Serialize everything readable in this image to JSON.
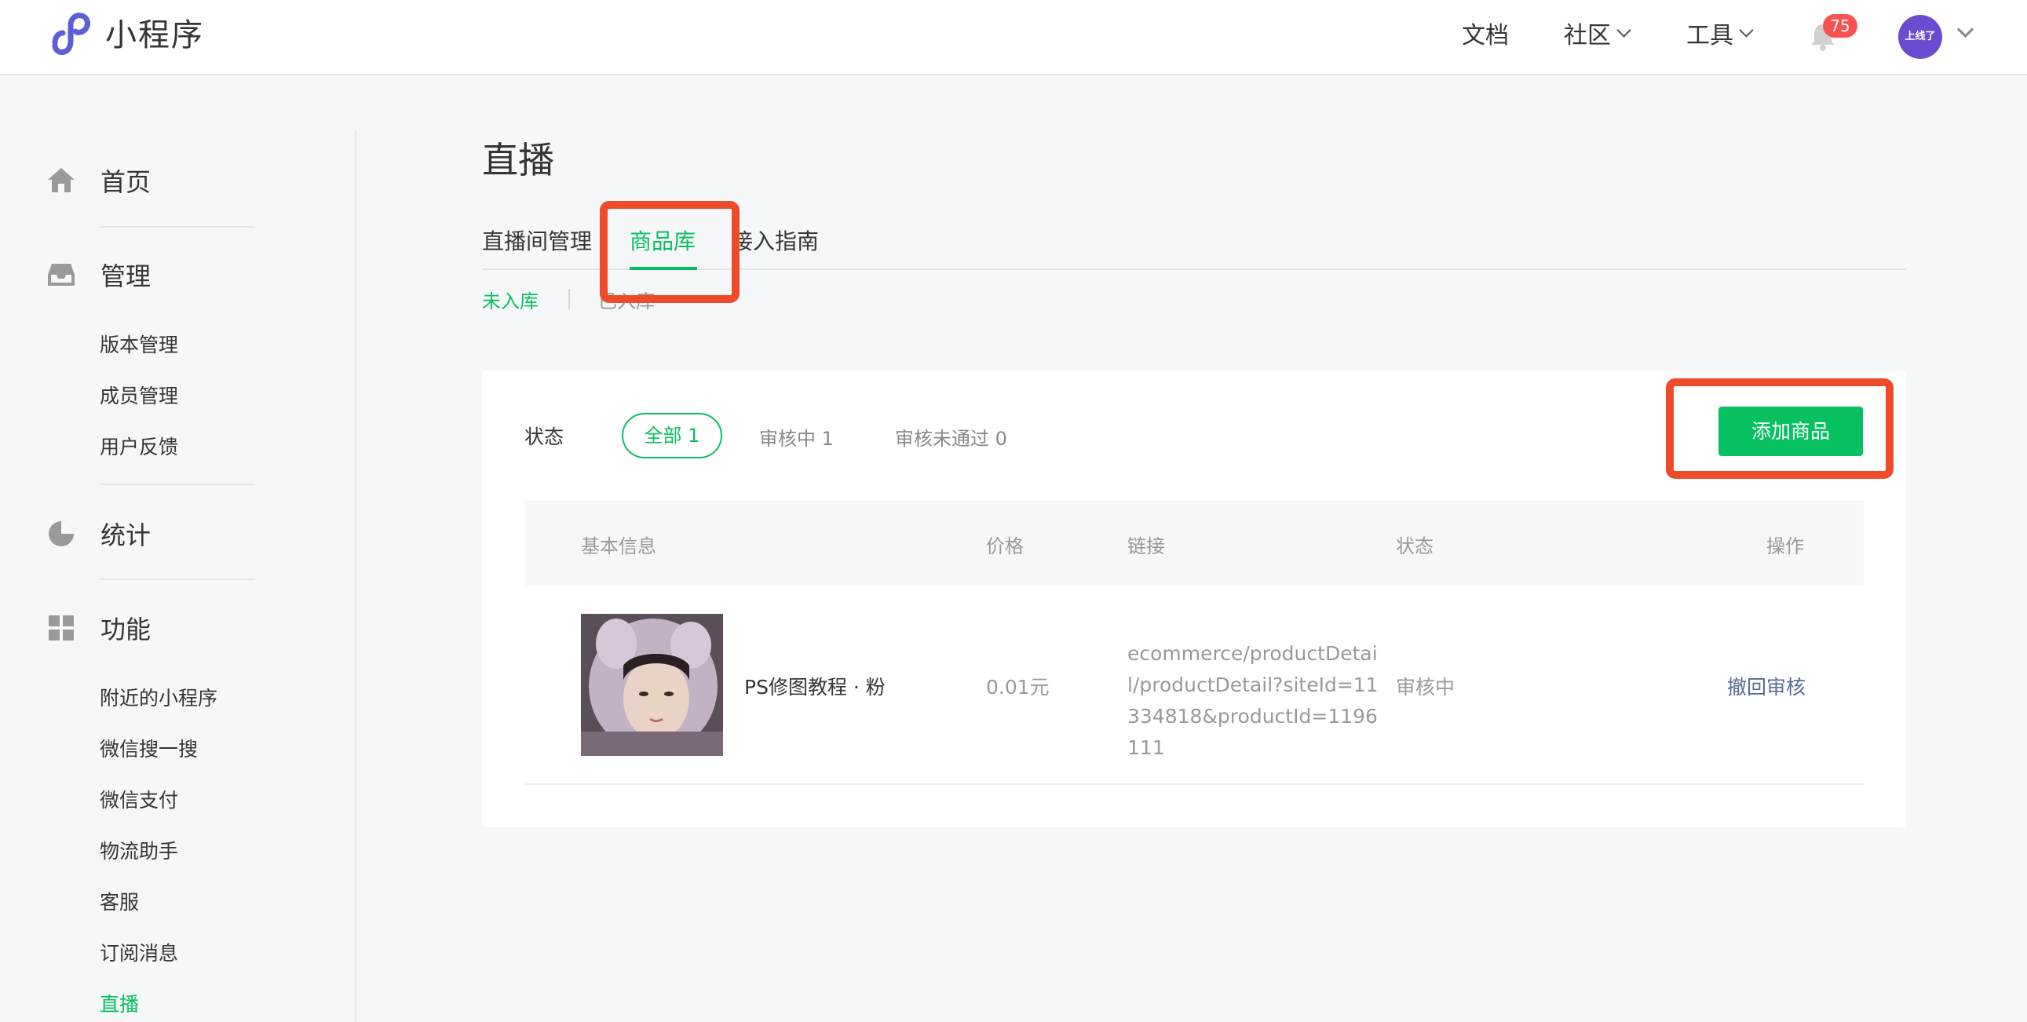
{
  "header": {
    "app_name": "小程序",
    "nav": [
      "文档",
      "社区",
      "工具"
    ],
    "notification_count": "75",
    "avatar_text": "上线了",
    "colors": {
      "brand": "#07c160",
      "logo": "#5b5fd8"
    }
  },
  "sidebar": {
    "groups": [
      {
        "label": "首页",
        "icon": "home-icon"
      },
      {
        "label": "管理",
        "icon": "inbox-icon"
      },
      {
        "label": "统计",
        "icon": "pie-chart-icon"
      },
      {
        "label": "功能",
        "icon": "grid-icon"
      }
    ],
    "manage_items": [
      "版本管理",
      "成员管理",
      "用户反馈"
    ],
    "feature_items": [
      "附近的小程序",
      "微信搜一搜",
      "微信支付",
      "物流助手",
      "客服",
      "订阅消息",
      "直播"
    ],
    "active_item": "直播"
  },
  "main": {
    "title": "直播",
    "tabs": [
      "直播间管理",
      "商品库",
      "接入指南"
    ],
    "active_tab": "商品库",
    "subtabs": [
      "未入库",
      "已入库"
    ],
    "active_subtab": "未入库",
    "filter": {
      "label": "状态",
      "options": [
        "全部 1",
        "审核中 1",
        "审核未通过 0"
      ],
      "active": "全部 1"
    },
    "add_button": "添加商品",
    "table": {
      "headers": [
        "基本信息",
        "价格",
        "链接",
        "状态",
        "操作"
      ],
      "rows": [
        {
          "name": "PS修图教程 · 粉",
          "price": "0.01元",
          "link": "ecommerce/productDetail/productDetail?siteId=11334818&productId=1196111",
          "status": "审核中",
          "action": "撤回审核"
        }
      ]
    }
  },
  "annotations": {
    "highlight_color": "#ee4b2b"
  }
}
